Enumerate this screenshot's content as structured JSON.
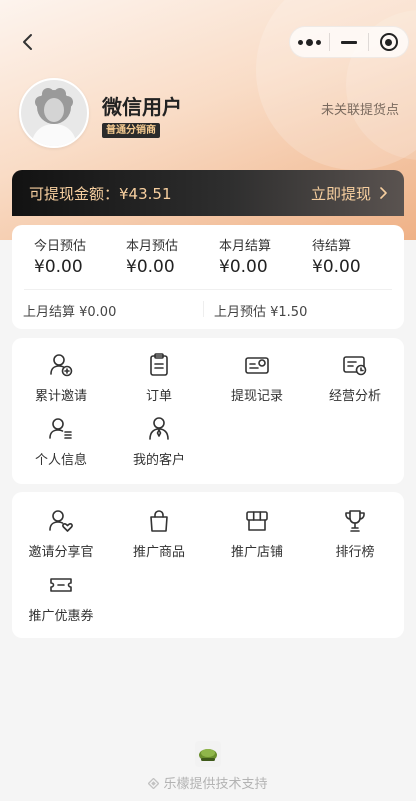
{
  "nav": {
    "back_icon": "chevron-left-icon",
    "capsule_icons": [
      "more-dots-icon",
      "minimize-icon",
      "close-circle-icon"
    ]
  },
  "profile": {
    "name": "微信用户",
    "level": "普通分销商",
    "unlinked_text": "未关联提货点"
  },
  "withdraw": {
    "label": "可提现金额：¥43.51",
    "action": "立即提现",
    "action_icon": "chevron-right-icon"
  },
  "stats": {
    "items": [
      {
        "label": "今日预估",
        "value": "¥0.00"
      },
      {
        "label": "本月预估",
        "value": "¥0.00"
      },
      {
        "label": "本月结算",
        "value": "¥0.00"
      },
      {
        "label": "待结算",
        "value": "¥0.00"
      }
    ],
    "last_month_settled": "上月结算 ¥0.00",
    "last_month_estimate": "上月预估 ¥1.50"
  },
  "menu_primary": [
    {
      "label": "累计邀请",
      "icon": "user-add-icon"
    },
    {
      "label": "订单",
      "icon": "clipboard-icon"
    },
    {
      "label": "提现记录",
      "icon": "cash-record-icon"
    },
    {
      "label": "经营分析",
      "icon": "analysis-icon"
    },
    {
      "label": "个人信息",
      "icon": "user-info-icon"
    },
    {
      "label": "我的客户",
      "icon": "customer-icon"
    }
  ],
  "menu_secondary": [
    {
      "label": "邀请分享官",
      "icon": "user-heart-icon"
    },
    {
      "label": "推广商品",
      "icon": "shopping-bag-icon"
    },
    {
      "label": "推广店铺",
      "icon": "store-icon"
    },
    {
      "label": "排行榜",
      "icon": "trophy-icon"
    },
    {
      "label": "推广优惠券",
      "icon": "coupon-icon"
    }
  ],
  "footer": {
    "text": "乐檬提供技术支持"
  },
  "colors": {
    "gold": "#f7cf9f",
    "header_gradient_start": "#fdf4ee",
    "header_gradient_end": "#efb186"
  }
}
